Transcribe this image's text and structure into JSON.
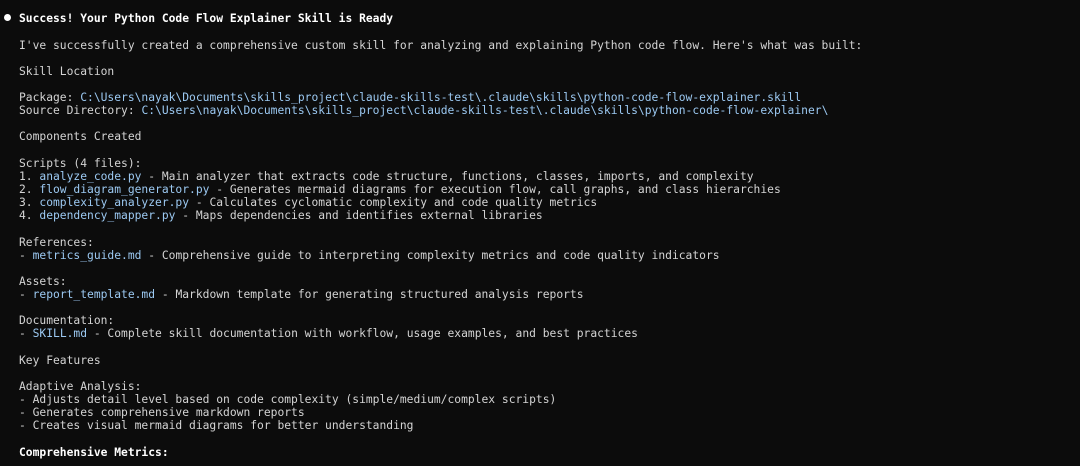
{
  "colors": {
    "background": "#0c0c0c",
    "text": "#d4d4d4",
    "heading": "#ffffff",
    "code": "#9cc9f2",
    "bullet": "#ffffff"
  },
  "status_bullet_icon": "filled-circle-icon",
  "title": "Success! Your Python Code Flow Explainer Skill is Ready",
  "intro": "I've successfully created a comprehensive custom skill for analyzing and explaining Python code flow. Here's what was built:",
  "skill_location": {
    "heading": "Skill Location",
    "package_label": "Package: ",
    "package_path": "C:\\Users\\nayak\\Documents\\skills_project\\claude-skills-test\\.claude\\skills\\python-code-flow-explainer.skill",
    "source_label": "Source Directory: ",
    "source_path": "C:\\Users\\nayak\\Documents\\skills_project\\claude-skills-test\\.claude\\skills\\python-code-flow-explainer\\"
  },
  "components": {
    "heading": "Components Created",
    "scripts_heading": "Scripts (4 files):",
    "scripts": [
      {
        "num": "1. ",
        "file": "analyze_code.py",
        "desc": " - Main analyzer that extracts code structure, functions, classes, imports, and complexity"
      },
      {
        "num": "2. ",
        "file": "flow_diagram_generator.py",
        "desc": " - Generates mermaid diagrams for execution flow, call graphs, and class hierarchies"
      },
      {
        "num": "3. ",
        "file": "complexity_analyzer.py",
        "desc": " - Calculates cyclomatic complexity and code quality metrics"
      },
      {
        "num": "4. ",
        "file": "dependency_mapper.py",
        "desc": " - Maps dependencies and identifies external libraries"
      }
    ],
    "references_heading": "References:",
    "references": {
      "prefix": "- ",
      "file": "metrics_guide.md",
      "desc": " - Comprehensive guide to interpreting complexity metrics and code quality indicators"
    },
    "assets_heading": "Assets:",
    "assets": {
      "prefix": "- ",
      "file": "report_template.md",
      "desc": " - Markdown template for generating structured analysis reports"
    },
    "documentation_heading": "Documentation:",
    "documentation": {
      "prefix": "- ",
      "file": "SKILL.md",
      "desc": " - Complete skill documentation with workflow, usage examples, and best practices"
    }
  },
  "key_features": {
    "heading": "Key Features",
    "adaptive_heading": "Adaptive Analysis:",
    "adaptive_items": [
      "- Adjusts detail level based on code complexity (simple/medium/complex scripts)",
      "- Generates comprehensive markdown reports",
      "- Creates visual mermaid diagrams for better understanding"
    ],
    "metrics_heading": "Comprehensive Metrics:"
  }
}
